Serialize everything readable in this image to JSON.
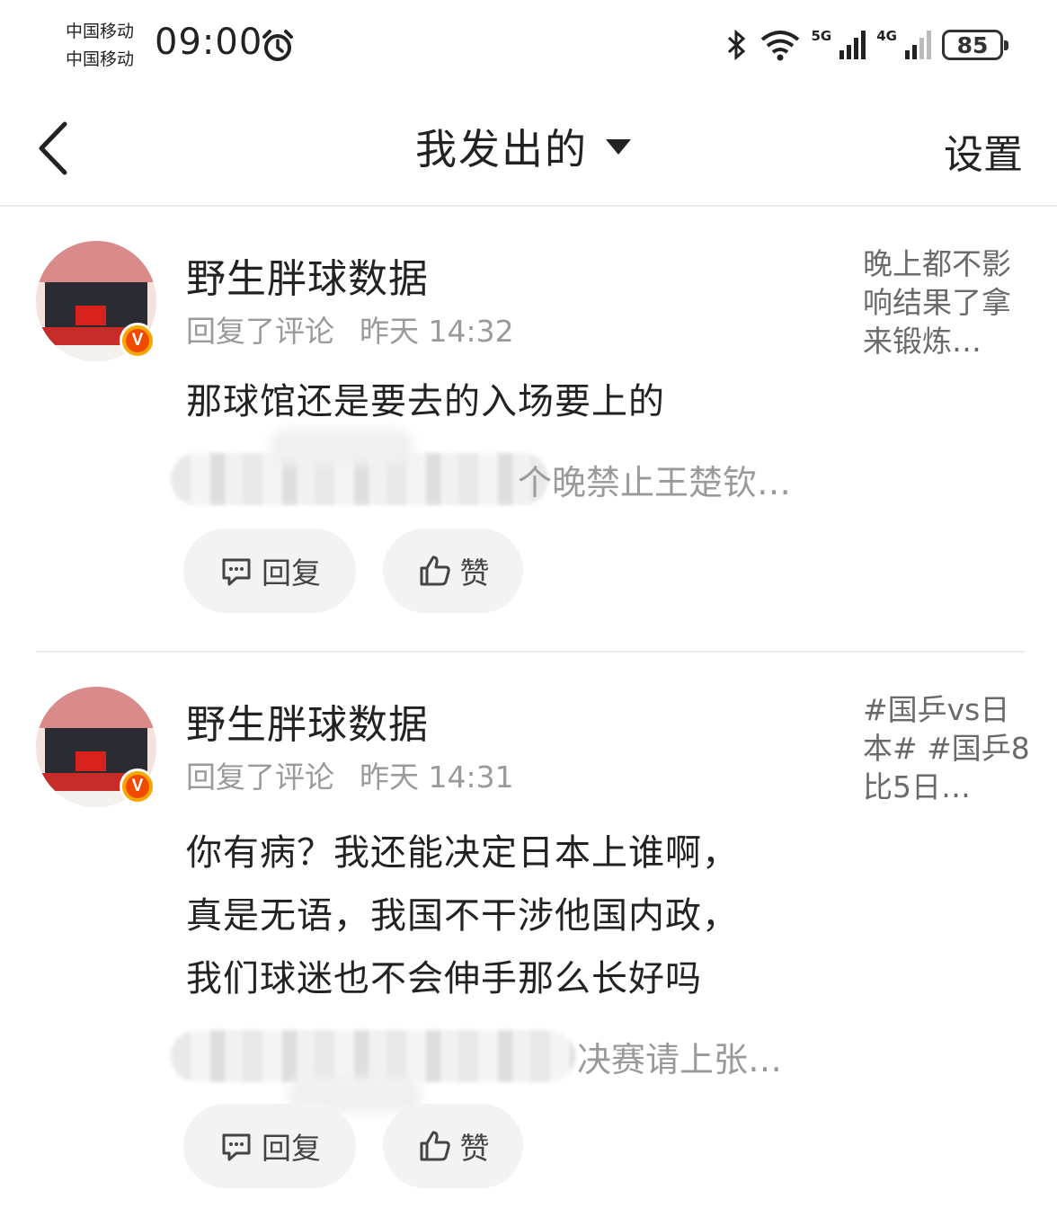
{
  "status_bar": {
    "carrier_1": "中国移动",
    "carrier_2": "中国移动",
    "time": "09:00",
    "network_1": "5G",
    "network_2": "4G",
    "battery": "85"
  },
  "header": {
    "title": "我发出的",
    "settings_label": "设置"
  },
  "items": [
    {
      "username": "野生胖球数据",
      "action": "回复了评论",
      "time": "昨天 14:32",
      "content_lines": [
        "那球馆还是要去的入场要上的"
      ],
      "quoted_visible": "个晚禁止王楚钦…",
      "right_snippet": "晚上都不影响结果了拿来锻炼…",
      "reply_label": "回复",
      "like_label": "赞"
    },
    {
      "username": "野生胖球数据",
      "action": "回复了评论",
      "time": "昨天 14:31",
      "content_lines": [
        "你有病？我还能决定日本上谁啊，",
        "真是无语，我国不干涉他国内政，",
        "我们球迷也不会伸手那么长好吗"
      ],
      "quoted_visible": "决赛请上张…",
      "right_snippet": "#国乒vs日本# #国乒8比5日…",
      "reply_label": "回复",
      "like_label": "赞"
    }
  ],
  "colors": {
    "badge_outer": "#f7a500",
    "badge_inner": "#f04a00",
    "meta_text": "#9a9a9a",
    "button_bg": "#f3f3f3"
  },
  "icons": [
    "alarm-icon",
    "bluetooth-icon",
    "wifi-icon",
    "signal-icon",
    "battery-icon",
    "back-arrow-icon",
    "dropdown-caret-icon",
    "verified-badge-icon",
    "comment-icon",
    "thumbs-up-icon"
  ]
}
